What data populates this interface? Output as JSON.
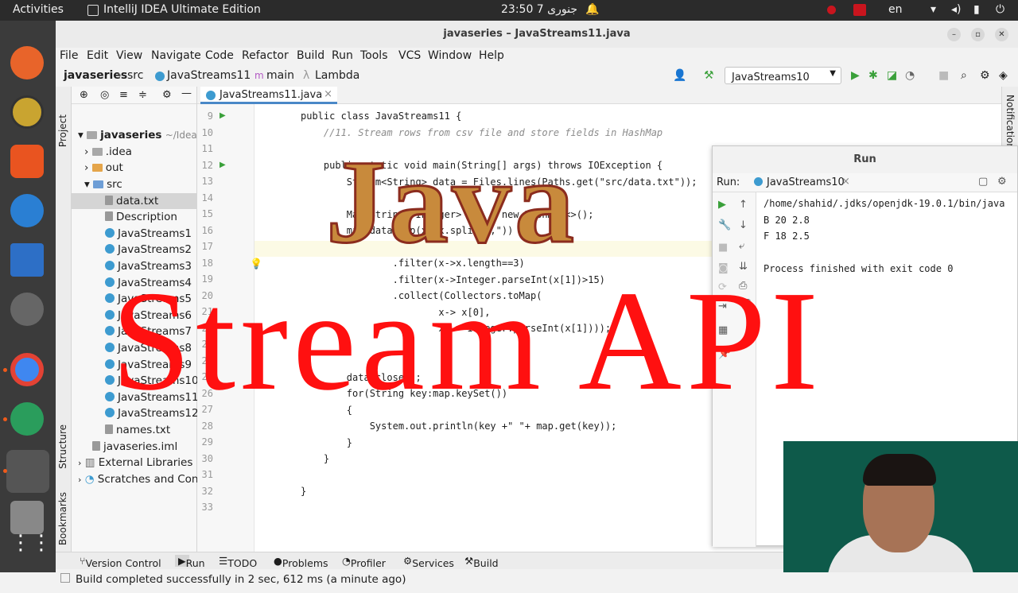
{
  "system": {
    "activities": "Activities",
    "app_name": "IntelliJ IDEA Ultimate Edition",
    "clock": "23:50  7 جنوری",
    "lang": "en",
    "accent_color": "#f05a1a"
  },
  "window": {
    "title": "javaseries – JavaStreams11.java"
  },
  "menu": [
    "File",
    "Edit",
    "View",
    "Navigate",
    "Code",
    "Refactor",
    "Build",
    "Run",
    "Tools",
    "VCS",
    "Window",
    "Help"
  ],
  "breadcrumb": [
    "javaseries",
    "src",
    "JavaStreams11",
    "main",
    "Lambda"
  ],
  "run_config": "JavaStreams10",
  "project": {
    "root_name": "javaseries",
    "root_path": "~/IdeaPro",
    "items": [
      {
        "label": ".idea",
        "type": "folder"
      },
      {
        "label": "out",
        "type": "folder-orange"
      },
      {
        "label": "src",
        "type": "folder"
      },
      {
        "label": "data.txt",
        "type": "file"
      },
      {
        "label": "Description",
        "type": "file"
      },
      {
        "label": "JavaStreams1",
        "type": "class"
      },
      {
        "label": "JavaStreams2",
        "type": "class"
      },
      {
        "label": "JavaStreams3",
        "type": "class"
      },
      {
        "label": "JavaStreams4",
        "type": "class"
      },
      {
        "label": "JavaStreams5",
        "type": "class"
      },
      {
        "label": "JavaStreams6",
        "type": "class"
      },
      {
        "label": "JavaStreams7",
        "type": "class"
      },
      {
        "label": "JavaStreams8",
        "type": "class"
      },
      {
        "label": "JavaStreams9",
        "type": "class"
      },
      {
        "label": "JavaStreams10",
        "type": "class"
      },
      {
        "label": "JavaStreams11",
        "type": "class"
      },
      {
        "label": "JavaStreams12",
        "type": "class"
      },
      {
        "label": "names.txt",
        "type": "file"
      },
      {
        "label": "javaseries.iml",
        "type": "file"
      },
      {
        "label": "External Libraries",
        "type": "lib"
      },
      {
        "label": "Scratches and Consoles",
        "type": "scratch"
      }
    ]
  },
  "left_strip": {
    "project": "Project",
    "structure": "Structure",
    "bookmarks": "Bookmarks"
  },
  "right_strip": {
    "notifications": "Notifications"
  },
  "editor": {
    "tab": "JavaStreams11.java",
    "warning_count": "1",
    "line_numbers": [
      "9",
      "10",
      "11",
      "12",
      "13",
      "14",
      "15",
      "16",
      "17",
      "18",
      "19",
      "20",
      "21",
      "22",
      "23",
      "24",
      "25",
      "26",
      "27",
      "28",
      "29",
      "30",
      "31",
      "32",
      "33"
    ],
    "lines": [
      "public class JavaStreams11 {",
      "    //11. Stream rows from csv file and store fields in HashMap",
      "",
      "    public static void main(String[] args) throws IOException {",
      "        Stream<String> data = Files.lines(Paths.get(\"src/data.txt\"));",
      "",
      "        Map<String, Integer> map = new HashMap<>();",
      "        map=data.map(x->x.split(\",\"))",
      "",
      "                .filter(x->x.length==3)",
      "                .filter(x->Integer.parseInt(x[1])>15)",
      "                .collect(Collectors.toMap(",
      "                        x-> x[0],",
      "                        x -> Integer.parseInt(x[1])));",
      "",
      "",
      "        data.close();",
      "        for(String key:map.keySet())",
      "        {",
      "            System.out.println(key +\" \"+ map.get(key));",
      "        }",
      "    }",
      "",
      "}",
      ""
    ]
  },
  "run_panel": {
    "title": "Run",
    "label": "Run:",
    "tab": "JavaStreams10",
    "output": [
      "/home/shahid/.jdks/openjdk-19.0.1/bin/java",
      "B 20 2.8",
      "F 18 2.5",
      "",
      "Process finished with exit code 0"
    ]
  },
  "bottom_tabs": [
    "Version Control",
    "Run",
    "TODO",
    "Problems",
    "Profiler",
    "Services",
    "Build"
  ],
  "status": "Build completed successfully in 2 sec, 612 ms (a minute ago)",
  "overlay": {
    "title_line1": "Java",
    "title_line2": "Stream API"
  }
}
